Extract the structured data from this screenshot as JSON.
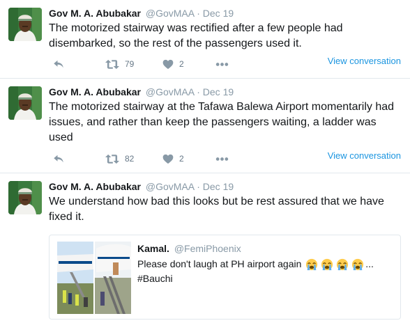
{
  "tweets": [
    {
      "author_name": "Gov M. A. Abubakar",
      "handle": "@GovMAA",
      "separator": "·",
      "date": "Dec 19",
      "text": "The motorized stairway was rectified after a few people had disembarked, so the rest of the passengers used it.",
      "retweets": "79",
      "likes": "2",
      "view_conversation": "View conversation"
    },
    {
      "author_name": "Gov M. A. Abubakar",
      "handle": "@GovMAA",
      "separator": "·",
      "date": "Dec 19",
      "text": "The motorized stairway at the Tafawa Balewa Airport momentarily had issues, and rather than keep the passengers waiting, a ladder was used",
      "retweets": "82",
      "likes": "2",
      "view_conversation": "View conversation"
    },
    {
      "author_name": "Gov M. A. Abubakar",
      "handle": "@GovMAA",
      "separator": "·",
      "date": "Dec 19",
      "text": "We understand how bad this looks but be rest assured that we have fixed it.",
      "quoted": {
        "author_name": "Kamal.",
        "handle": "@FemiPhoenix",
        "text_before": "Please don't laugh at PH airport again",
        "text_after": "...",
        "hashtag": "#Bauchi"
      }
    }
  ],
  "icons": {
    "reply": "reply-icon",
    "retweet": "retweet-icon",
    "like": "heart-icon",
    "more": "more-icon",
    "emoji": "loudly-crying-face-icon"
  },
  "colors": {
    "link": "#1b95e0",
    "muted": "#8899a6",
    "action": "#657786",
    "border": "#e1e8ed",
    "text": "#14171a"
  }
}
